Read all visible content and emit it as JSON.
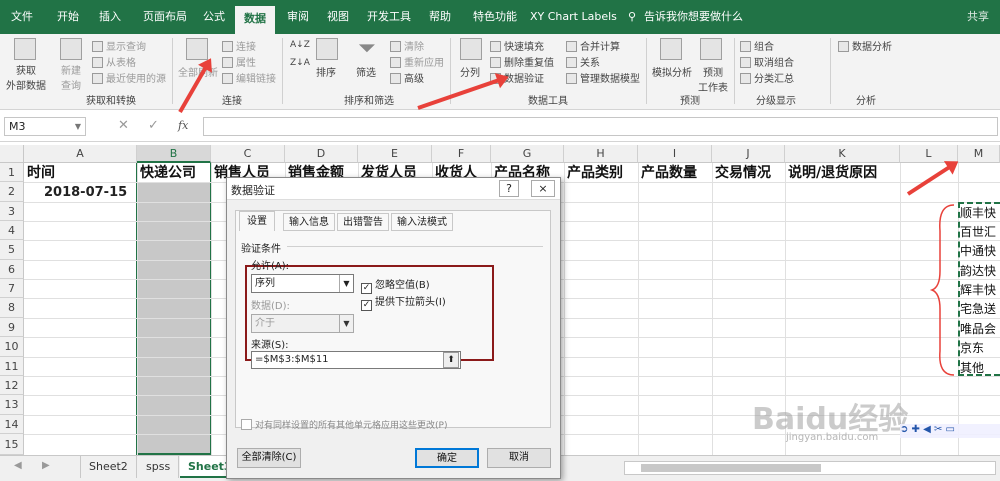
{
  "tabs": [
    "文件",
    "开始",
    "插入",
    "页面布局",
    "公式",
    "数据",
    "审阅",
    "视图",
    "开发工具",
    "帮助",
    "特色功能",
    "XY Chart Labels"
  ],
  "search_text": "告诉我你想要做什么",
  "share_label": "共享",
  "ribbon": {
    "get_external": "获取\n外部数据",
    "new_query": "新建\n查询",
    "show_query": "显示查询",
    "from_table": "从表格",
    "recent_sources": "最近使用的源",
    "refresh_all": "全部刷新",
    "connections": "连接",
    "properties": "属性",
    "edit_links": "编辑链接",
    "sort": "排序",
    "filter": "筛选",
    "clear": "清除",
    "reapply": "重新应用",
    "advanced": "高级",
    "split": "分列",
    "flash_fill": "快速填充",
    "remove_dup": "删除重复值",
    "data_validation": "数据验证",
    "consolidate": "合并计算",
    "relationships": "关系",
    "manage_model": "管理数据模型",
    "what_if": "模拟分析",
    "forecast_sheet": "预测\n工作表",
    "group": "组合",
    "ungroup": "取消组合",
    "subtotal": "分类汇总",
    "data_analysis": "数据分析",
    "groups": [
      "获取和转换",
      "连接",
      "排序和筛选",
      "数据工具",
      "预测",
      "分级显示",
      "分析"
    ]
  },
  "formula_bar": {
    "name_box": "M3",
    "fx": "fx",
    "formula": ""
  },
  "columns": [
    "A",
    "B",
    "C",
    "D",
    "E",
    "F",
    "G",
    "H",
    "I",
    "J",
    "K",
    "L",
    "M"
  ],
  "rows": [
    "1",
    "2",
    "3",
    "4",
    "5",
    "6",
    "7",
    "8",
    "9",
    "10",
    "11",
    "12",
    "13",
    "14",
    "15"
  ],
  "headers": [
    "时间",
    "快递公司",
    "销售人员",
    "销售金额",
    "发货人员",
    "收货人",
    "产品名称",
    "产品类别",
    "产品数量",
    "交易情况",
    "说明/退货原因"
  ],
  "a2_value": "2018-07-15",
  "m_values": [
    "顺丰快",
    "百世汇",
    "中通快",
    "韵达快",
    "辉丰快",
    "宅急送",
    "唯品会",
    "京东",
    "其他"
  ],
  "dialog": {
    "title": "数据验证",
    "help": "?",
    "close": "×",
    "tabs": [
      "设置",
      "输入信息",
      "出错警告",
      "输入法模式"
    ],
    "section": "验证条件",
    "allow_label": "允许(A):",
    "allow_value": "序列",
    "ignore_blank": "忽略空值(B)",
    "dropdown": "提供下拉箭头(I)",
    "data_label": "数据(D):",
    "data_value": "介于",
    "source_label": "来源(S):",
    "source_value": "=$M$3:$M$11",
    "apply_all": "对有同样设置的所有其他单元格应用这些更改(P)",
    "clear_all": "全部清除(C)",
    "ok": "确定",
    "cancel": "取消"
  },
  "sheets": [
    "Sheet2",
    "spss",
    "Sheet3"
  ],
  "watermark": "Baidu经验",
  "watermark_sub": "jingyan.baidu.com",
  "colors": {
    "excel_green": "#217346",
    "annotation_red": "#e8413a",
    "box_border": "#8b1a1a"
  }
}
